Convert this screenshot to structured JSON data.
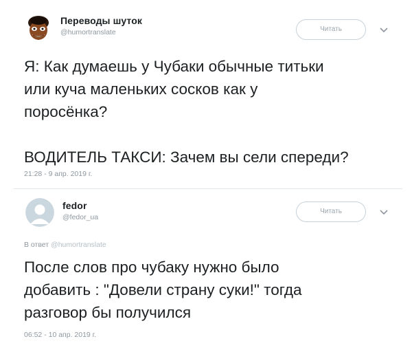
{
  "tweet1": {
    "author_name": "Переводы шуток",
    "author_handle": "@humortranslate",
    "follow_label": "Читать",
    "body": "Я: Как думаешь у Чубаки обычные титьки\nили куча маленьких сосков как у\nпоросёнка?\n\nВОДИТЕЛЬ ТАКСИ: Зачем вы сели спереди?",
    "timestamp": "21:28 - 9 апр. 2019 г."
  },
  "tweet2": {
    "author_name": "fedor",
    "author_handle": "@fedor_ua",
    "follow_label": "Читать",
    "reply_prefix": "В ответ",
    "reply_handle": "@humortranslate",
    "body": "После слов про чубаку нужно было\nдобавить : \"Довели страну суки!\" тогда\nразговор бы получился",
    "timestamp": "06:52 - 10 апр. 2019 г."
  },
  "icons": {
    "chevron": "chevron-down-icon",
    "avatar1": "cartoon-face-avatar",
    "avatar2": "default-user-avatar"
  },
  "colors": {
    "text": "#1c2022",
    "muted": "#8e979f",
    "border": "#e1e8ed"
  }
}
